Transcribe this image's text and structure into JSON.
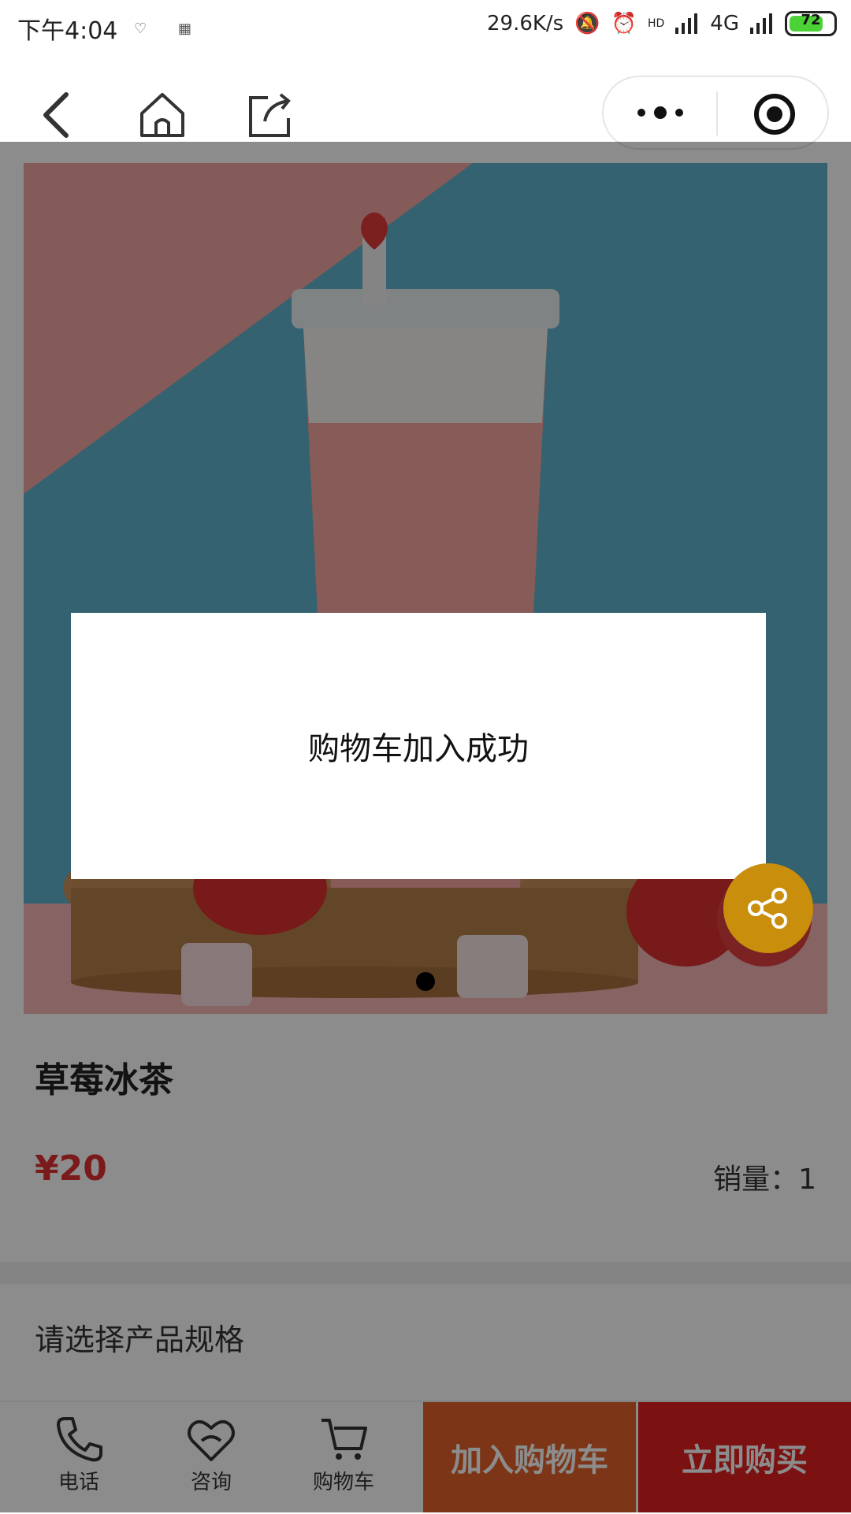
{
  "status_bar": {
    "time": "下午4:04",
    "net_speed": "29.6K/s",
    "hd": "HD",
    "network": "4G",
    "battery": "72"
  },
  "product": {
    "title": "草莓冰茶",
    "price": "¥20",
    "sales": "销量：1",
    "spec_prompt": "请选择产品规格"
  },
  "toast": {
    "message": "购物车加入成功"
  },
  "bottom_bar": {
    "phone_label": "电话",
    "consult_label": "咨询",
    "cart_label": "购物车",
    "add_to_cart": "加入购物车",
    "buy_now": "立即购买"
  },
  "colors": {
    "price": "#e03030",
    "add_to_cart_bg": "#e2632a",
    "buy_now_bg": "#e02020",
    "share_fab": "#f0a500"
  },
  "icons": {
    "back": "back-icon",
    "home": "home-icon",
    "share": "share-icon",
    "more": "more-icon",
    "close_miniprogram": "target-icon",
    "phone": "phone-icon",
    "consult": "heart-chat-icon",
    "cart": "cart-icon"
  }
}
